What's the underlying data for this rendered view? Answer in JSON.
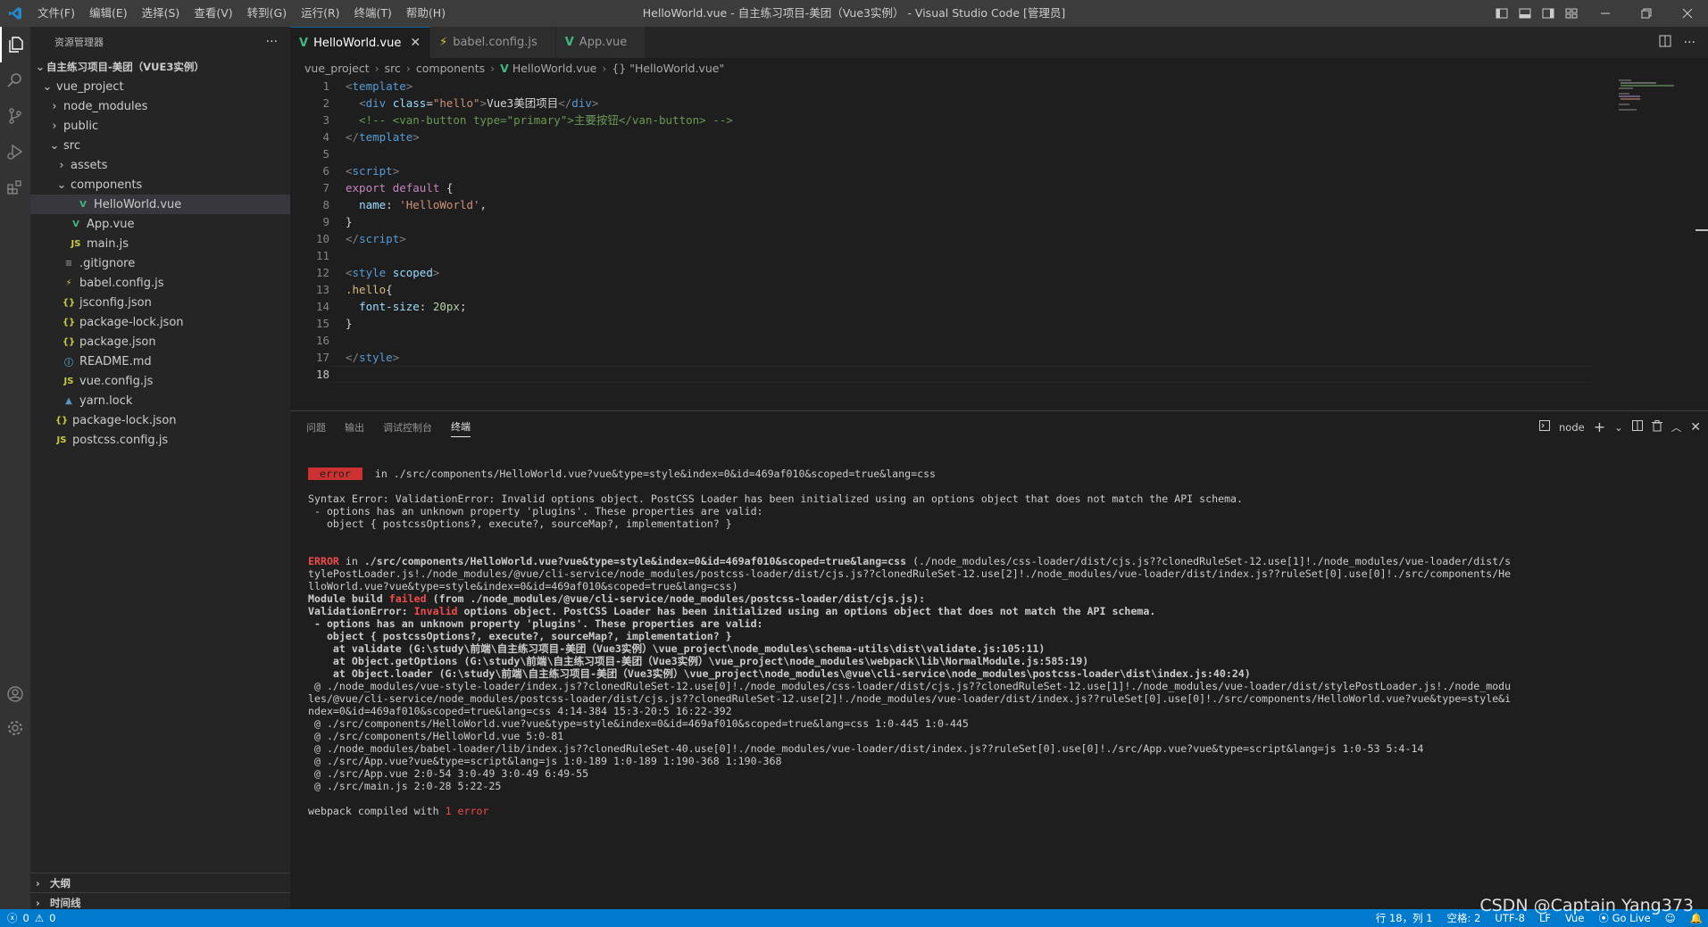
{
  "titlebar": {
    "menu": [
      "文件(F)",
      "编辑(E)",
      "选择(S)",
      "查看(V)",
      "转到(G)",
      "运行(R)",
      "终端(T)",
      "帮助(H)"
    ],
    "window_title": "HelloWorld.vue - 自主练习项目-美团（Vue3实例） - Visual Studio Code [管理员]"
  },
  "sidebar": {
    "title": "资源管理器",
    "more": "···",
    "root": "自主练习项目-美团（VUE3实例）",
    "items": [
      {
        "label": "vue_project",
        "indent": 1,
        "chev": "⌄",
        "icon": "",
        "color": "#cccccc"
      },
      {
        "label": "node_modules",
        "indent": 2,
        "chev": "›",
        "icon": "",
        "color": "#cccccc"
      },
      {
        "label": "public",
        "indent": 2,
        "chev": "›",
        "icon": "",
        "color": "#cccccc"
      },
      {
        "label": "src",
        "indent": 2,
        "chev": "⌄",
        "icon": "",
        "color": "#cccccc"
      },
      {
        "label": "assets",
        "indent": 3,
        "chev": "›",
        "icon": "",
        "color": "#cccccc"
      },
      {
        "label": "components",
        "indent": 3,
        "chev": "⌄",
        "icon": "",
        "color": "#cccccc"
      },
      {
        "label": "HelloWorld.vue",
        "indent": 4,
        "chev": "",
        "icon": "V",
        "color": "#41b883",
        "selected": true
      },
      {
        "label": "App.vue",
        "indent": 3,
        "chev": "",
        "icon": "V",
        "color": "#41b883"
      },
      {
        "label": "main.js",
        "indent": 3,
        "chev": "",
        "icon": "JS",
        "color": "#cbcb41"
      },
      {
        "label": ".gitignore",
        "indent": 2,
        "chev": "",
        "icon": "≡",
        "color": "#8c8c8c"
      },
      {
        "label": "babel.config.js",
        "indent": 2,
        "chev": "",
        "icon": "⚡",
        "color": "#cbcb41"
      },
      {
        "label": "jsconfig.json",
        "indent": 2,
        "chev": "",
        "icon": "{}",
        "color": "#cbcb41"
      },
      {
        "label": "package-lock.json",
        "indent": 2,
        "chev": "",
        "icon": "{}",
        "color": "#cbcb41"
      },
      {
        "label": "package.json",
        "indent": 2,
        "chev": "",
        "icon": "{}",
        "color": "#cbcb41"
      },
      {
        "label": "README.md",
        "indent": 2,
        "chev": "",
        "icon": "ⓘ",
        "color": "#519aba"
      },
      {
        "label": "vue.config.js",
        "indent": 2,
        "chev": "",
        "icon": "JS",
        "color": "#cbcb41"
      },
      {
        "label": "yarn.lock",
        "indent": 2,
        "chev": "",
        "icon": "▲",
        "color": "#519aba"
      },
      {
        "label": "package-lock.json",
        "indent": 1,
        "chev": "",
        "icon": "{}",
        "color": "#cbcb41"
      },
      {
        "label": "postcss.config.js",
        "indent": 1,
        "chev": "",
        "icon": "JS",
        "color": "#cbcb41"
      }
    ],
    "outline": "大纲",
    "timeline": "时间线"
  },
  "tabs": [
    {
      "label": "HelloWorld.vue",
      "icon": "V",
      "color": "#41b883",
      "active": true
    },
    {
      "label": "babel.config.js",
      "icon": "⚡",
      "color": "#cbcb41",
      "active": false
    },
    {
      "label": "App.vue",
      "icon": "V",
      "color": "#41b883",
      "active": false
    }
  ],
  "breadcrumb": [
    "vue_project",
    "src",
    "components",
    "HelloWorld.vue",
    "{} \"HelloWorld.vue\""
  ],
  "editor": {
    "current_line": 18,
    "lines": [
      [
        [
          "t-tag",
          "<"
        ],
        [
          "t-tagname",
          "template"
        ],
        [
          "t-tag",
          ">"
        ]
      ],
      [
        [
          "t-text",
          "  "
        ],
        [
          "t-tag",
          "<"
        ],
        [
          "t-tagname",
          "div"
        ],
        [
          "t-text",
          " "
        ],
        [
          "t-attr",
          "class"
        ],
        [
          "t-text",
          "="
        ],
        [
          "t-str",
          "\"hello\""
        ],
        [
          "t-tag",
          ">"
        ],
        [
          "t-text",
          "Vue3美团项目"
        ],
        [
          "t-tag",
          "</"
        ],
        [
          "t-tagname",
          "div"
        ],
        [
          "t-tag",
          ">"
        ]
      ],
      [
        [
          "t-comment",
          "  <!-- <van-button type=\"primary\">主要按钮</van-button> -->"
        ]
      ],
      [
        [
          "t-tag",
          "</"
        ],
        [
          "t-tagname",
          "template"
        ],
        [
          "t-tag",
          ">"
        ]
      ],
      [],
      [
        [
          "t-tag",
          "<"
        ],
        [
          "t-tagname",
          "script"
        ],
        [
          "t-tag",
          ">"
        ]
      ],
      [
        [
          "t-kw",
          "export"
        ],
        [
          "t-text",
          " "
        ],
        [
          "t-kw",
          "default"
        ],
        [
          "t-text",
          " {"
        ]
      ],
      [
        [
          "t-text",
          "  "
        ],
        [
          "t-attr",
          "name"
        ],
        [
          "t-text",
          ": "
        ],
        [
          "t-str",
          "'HelloWorld'"
        ],
        [
          "t-text",
          ","
        ]
      ],
      [
        [
          "t-text",
          "}"
        ]
      ],
      [
        [
          "t-tag",
          "</"
        ],
        [
          "t-tagname",
          "script"
        ],
        [
          "t-tag",
          ">"
        ]
      ],
      [],
      [
        [
          "t-tag",
          "<"
        ],
        [
          "t-tagname",
          "style"
        ],
        [
          "t-text",
          " "
        ],
        [
          "t-attr",
          "scoped"
        ],
        [
          "t-tag",
          ">"
        ]
      ],
      [
        [
          "t-sel",
          ".hello"
        ],
        [
          "t-text",
          "{"
        ]
      ],
      [
        [
          "t-text",
          "  "
        ],
        [
          "t-attr",
          "font-size"
        ],
        [
          "t-text",
          ": "
        ],
        [
          "t-num",
          "20px"
        ],
        [
          "t-text",
          ";"
        ]
      ],
      [
        [
          "t-text",
          "}"
        ]
      ],
      [],
      [
        [
          "t-tag",
          "</"
        ],
        [
          "t-tagname",
          "style"
        ],
        [
          "t-tag",
          ">"
        ]
      ],
      []
    ]
  },
  "panel": {
    "tabs": [
      "问题",
      "输出",
      "调试控制台",
      "终端"
    ],
    "active_tab": "终端",
    "terminal_name": "node",
    "terminal_lines": [
      {
        "segments": [
          [
            "badge",
            " error "
          ],
          [
            "",
            "  in ./src/components/HelloWorld.vue?vue&type=style&index=0&id=469af010&scoped=true&lang=css"
          ]
        ]
      },
      {
        "segments": []
      },
      {
        "segments": [
          [
            "",
            "Syntax Error: ValidationError: Invalid options object. PostCSS Loader has been initialized using an options object that does not match the API schema."
          ]
        ]
      },
      {
        "segments": [
          [
            "",
            " - options has an unknown property 'plugins'. These properties are valid:"
          ]
        ]
      },
      {
        "segments": [
          [
            "",
            "   object { postcssOptions?, execute?, sourceMap?, implementation? }"
          ]
        ]
      },
      {
        "segments": []
      },
      {
        "segments": []
      },
      {
        "segments": [
          [
            "red-bold",
            "ERROR"
          ],
          [
            "",
            " in "
          ],
          [
            "bold",
            "./src/components/HelloWorld.vue?vue&type=style&index=0&id=469af010&scoped=true&lang=css"
          ],
          [
            "",
            " (./node_modules/css-loader/dist/cjs.js??clonedRuleSet-12.use[1]!./node_modules/vue-loader/dist/s"
          ]
        ]
      },
      {
        "segments": [
          [
            "",
            "tylePostLoader.js!./node_modules/@vue/cli-service/node_modules/postcss-loader/dist/cjs.js??clonedRuleSet-12.use[2]!./node_modules/vue-loader/dist/index.js??ruleSet[0].use[0]!./src/components/He"
          ]
        ]
      },
      {
        "segments": [
          [
            "",
            "lloWorld.vue?vue&type=style&index=0&id=469af010&scoped=true&lang=css)"
          ]
        ]
      },
      {
        "segments": [
          [
            "bold",
            "Module build "
          ],
          [
            "red-bold",
            "failed"
          ],
          [
            "bold",
            " (from ./node_modules/@vue/cli-service/node_modules/postcss-loader/dist/cjs.js):"
          ]
        ]
      },
      {
        "segments": [
          [
            "bold",
            "ValidationError: "
          ],
          [
            "red-bold",
            "Invalid"
          ],
          [
            "bold",
            " options object. PostCSS Loader has been initialized using an options object that does not match the API schema."
          ]
        ]
      },
      {
        "segments": [
          [
            "bold",
            " - options has an unknown property 'plugins'. These properties are valid:"
          ]
        ]
      },
      {
        "segments": [
          [
            "bold",
            "   object { postcssOptions?, execute?, sourceMap?, implementation? }"
          ]
        ]
      },
      {
        "segments": [
          [
            "bold",
            "    at validate (G:\\study\\前端\\自主练习项目-美团（Vue3实例）\\vue_project\\node_modules\\schema-utils\\dist\\validate.js:105:11)"
          ]
        ]
      },
      {
        "segments": [
          [
            "bold",
            "    at Object.getOptions (G:\\study\\前端\\自主练习项目-美团（Vue3实例）\\vue_project\\node_modules\\webpack\\lib\\NormalModule.js:585:19)"
          ]
        ]
      },
      {
        "segments": [
          [
            "bold",
            "    at Object.loader (G:\\study\\前端\\自主练习项目-美团（Vue3实例）\\vue_project\\node_modules\\@vue\\cli-service\\node_modules\\postcss-loader\\dist\\index.js:40:24)"
          ]
        ]
      },
      {
        "segments": [
          [
            "",
            " @ ./node_modules/vue-style-loader/index.js??clonedRuleSet-12.use[0]!./node_modules/css-loader/dist/cjs.js??clonedRuleSet-12.use[1]!./node_modules/vue-loader/dist/stylePostLoader.js!./node_modu"
          ]
        ]
      },
      {
        "segments": [
          [
            "",
            "les/@vue/cli-service/node_modules/postcss-loader/dist/cjs.js??clonedRuleSet-12.use[2]!./node_modules/vue-loader/dist/index.js??ruleSet[0].use[0]!./src/components/HelloWorld.vue?vue&type=style&i"
          ]
        ]
      },
      {
        "segments": [
          [
            "",
            "ndex=0&id=469af010&scoped=true&lang=css 4:14-384 15:3-20:5 16:22-392"
          ]
        ]
      },
      {
        "segments": [
          [
            "",
            " @ ./src/components/HelloWorld.vue?vue&type=style&index=0&id=469af010&scoped=true&lang=css 1:0-445 1:0-445"
          ]
        ]
      },
      {
        "segments": [
          [
            "",
            " @ ./src/components/HelloWorld.vue 5:0-81"
          ]
        ]
      },
      {
        "segments": [
          [
            "",
            " @ ./node_modules/babel-loader/lib/index.js??clonedRuleSet-40.use[0]!./node_modules/vue-loader/dist/index.js??ruleSet[0].use[0]!./src/App.vue?vue&type=script&lang=js 1:0-53 5:4-14"
          ]
        ]
      },
      {
        "segments": [
          [
            "",
            " @ ./src/App.vue?vue&type=script&lang=js 1:0-189 1:0-189 1:190-368 1:190-368"
          ]
        ]
      },
      {
        "segments": [
          [
            "",
            " @ ./src/App.vue 2:0-54 3:0-49 3:0-49 6:49-55"
          ]
        ]
      },
      {
        "segments": [
          [
            "",
            " @ ./src/main.js 2:0-28 5:22-25"
          ]
        ]
      },
      {
        "segments": []
      },
      {
        "segments": [
          [
            "",
            "webpack compiled with "
          ],
          [
            "red",
            "1"
          ],
          [
            "red",
            " error"
          ]
        ]
      }
    ]
  },
  "statusbar": {
    "errors": "0",
    "warnings": "0",
    "position": "行 18，列 1",
    "spaces": "空格: 2",
    "encoding": "UTF-8",
    "eol": "LF",
    "language": "Vue",
    "golive": "Go Live"
  },
  "watermark": "CSDN @Captain Yang373",
  "colors": {
    "accent": "#007acc",
    "vue": "#41b883",
    "error": "#f14c4c"
  }
}
